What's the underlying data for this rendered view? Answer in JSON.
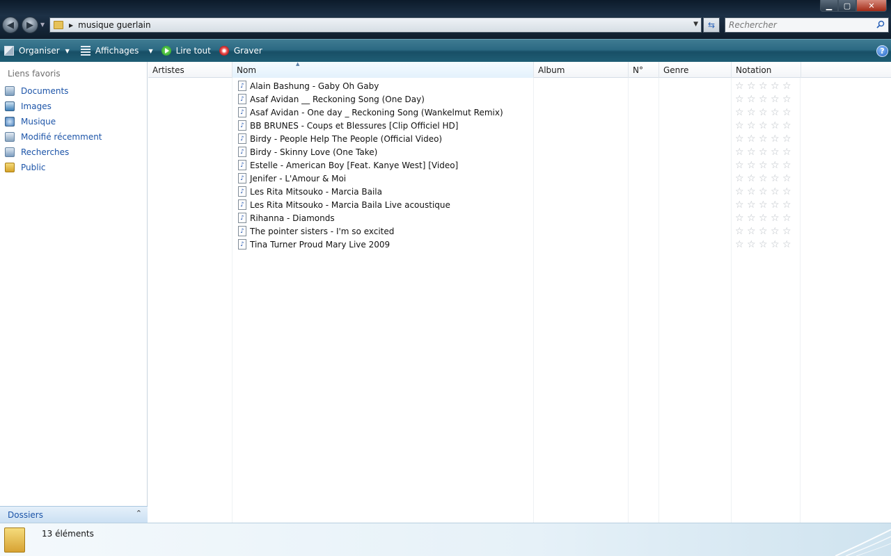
{
  "window": {
    "controls": {
      "minimize": "▁",
      "maximize": "▢",
      "close": "✕"
    }
  },
  "nav": {
    "back": "◀",
    "forward": "▶",
    "history_dropdown": "▼"
  },
  "address": {
    "path": "musique guerlain",
    "chevron": "▶",
    "dropdown": "▼"
  },
  "refresh_glyph": "⇆",
  "search": {
    "placeholder": "Rechercher"
  },
  "commands": {
    "organise": "Organiser",
    "views": "Affichages",
    "play_all": "Lire tout",
    "burn": "Graver",
    "dropdown": "▼",
    "help": "?"
  },
  "sidebar": {
    "title": "Liens favoris",
    "items": [
      {
        "label": "Documents",
        "icon": "documents-icon"
      },
      {
        "label": "Images",
        "icon": "images-icon"
      },
      {
        "label": "Musique",
        "icon": "music-icon"
      },
      {
        "label": "Modifié récemment",
        "icon": "recent-icon"
      },
      {
        "label": "Recherches",
        "icon": "searches-icon"
      },
      {
        "label": "Public",
        "icon": "public-folder-icon"
      }
    ],
    "folders_label": "Dossiers",
    "folders_chevron": "⌃"
  },
  "columns": {
    "artists": "Artistes",
    "name": "Nom",
    "album": "Album",
    "number": "N°",
    "genre": "Genre",
    "rating": "Notation",
    "sort_arrow": "▲"
  },
  "files": [
    "Alain Bashung - Gaby Oh Gaby",
    "Asaf Avidan  __ Reckoning Song (One Day)",
    "Asaf Avidan - One day _ Reckoning Song (Wankelmut Remix)",
    "BB BRUNES - Coups et Blessures [Clip Officiel HD]",
    "Birdy - People Help The People (Official Video)",
    "Birdy - Skinny Love (One Take)",
    "Estelle - American Boy [Feat. Kanye West] [Video]",
    "Jenifer - L'Amour & Moi",
    "Les Rita Mitsouko - Marcia Baila",
    "Les Rita Mitsouko - Marcia Baila Live acoustique",
    "Rihanna - Diamonds",
    "The pointer sisters - I'm so excited",
    "Tina Turner Proud Mary Live 2009"
  ],
  "ratings": [
    0,
    0,
    0,
    0,
    0,
    0,
    0,
    0,
    0,
    0,
    0,
    0,
    0
  ],
  "rating_max": 5,
  "status": {
    "count_text": "13 éléments"
  },
  "colors": {
    "link": "#1c54a8",
    "cmdbar": "#2c6a83",
    "titlebar": "#1d3146"
  }
}
